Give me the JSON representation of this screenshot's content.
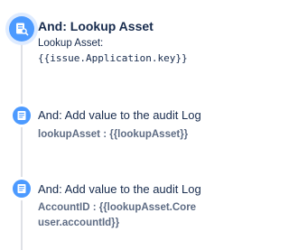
{
  "steps": [
    {
      "icon": "search-document-icon",
      "title": "And: Lookup Asset",
      "label": "Lookup Asset:",
      "value": "{{issue.Application.key}}"
    },
    {
      "icon": "document-icon",
      "title": "And: Add value to the audit Log",
      "detail": "lookupAsset : {{lookupAsset}}"
    },
    {
      "icon": "document-icon",
      "title": "And: Add value to the audit Log",
      "detail_lines": [
        "AccountID : {{lookupAsset.Core",
        "user.accountId}}"
      ]
    }
  ],
  "colors": {
    "icon_blue": "#4c9aff",
    "rail": "#dfe1e6",
    "text": "#172b4d",
    "muted": "#5e6c84"
  }
}
